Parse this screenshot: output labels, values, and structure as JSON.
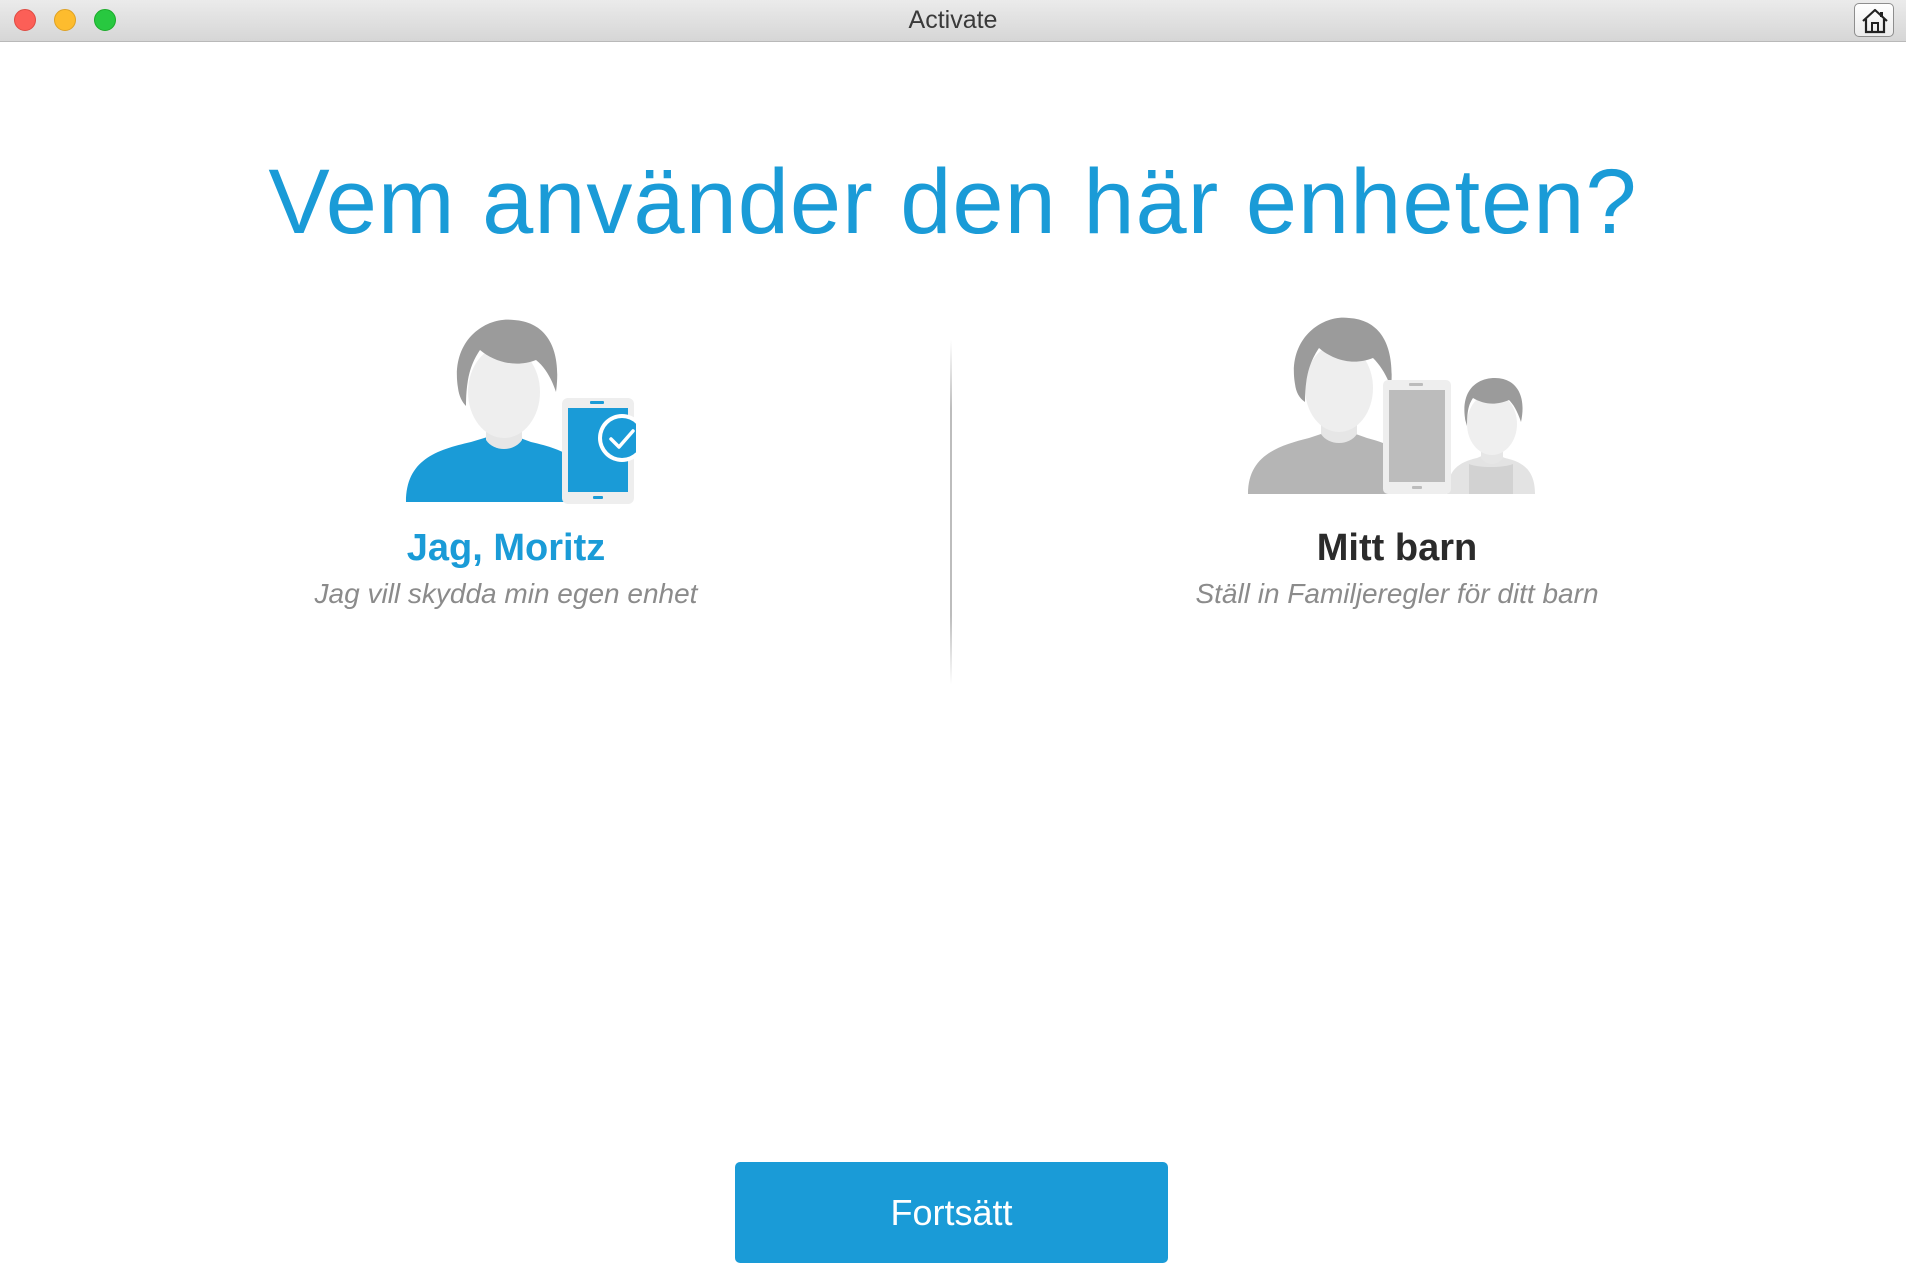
{
  "window": {
    "title": "Activate",
    "controls": [
      "close",
      "minimize",
      "zoom"
    ],
    "home_icon": "home-icon"
  },
  "main": {
    "heading": "Vem använder den här enheten?",
    "options": [
      {
        "title": "Jag, Moritz",
        "subtitle": "Jag vill skydda min egen enhet",
        "icon": "person-with-tablet-check-icon",
        "selected": true
      },
      {
        "title": "Mitt barn",
        "subtitle": "Ställ in Familjeregler för ditt barn",
        "icon": "parent-tablet-child-icon",
        "selected": false
      }
    ],
    "continue_label": "Fortsätt"
  },
  "colors": {
    "accent": "#1a9bd7",
    "muted_gray": "#9b9b9b",
    "text_dark": "#2b2b2b",
    "subtext": "#8b8b8b"
  }
}
